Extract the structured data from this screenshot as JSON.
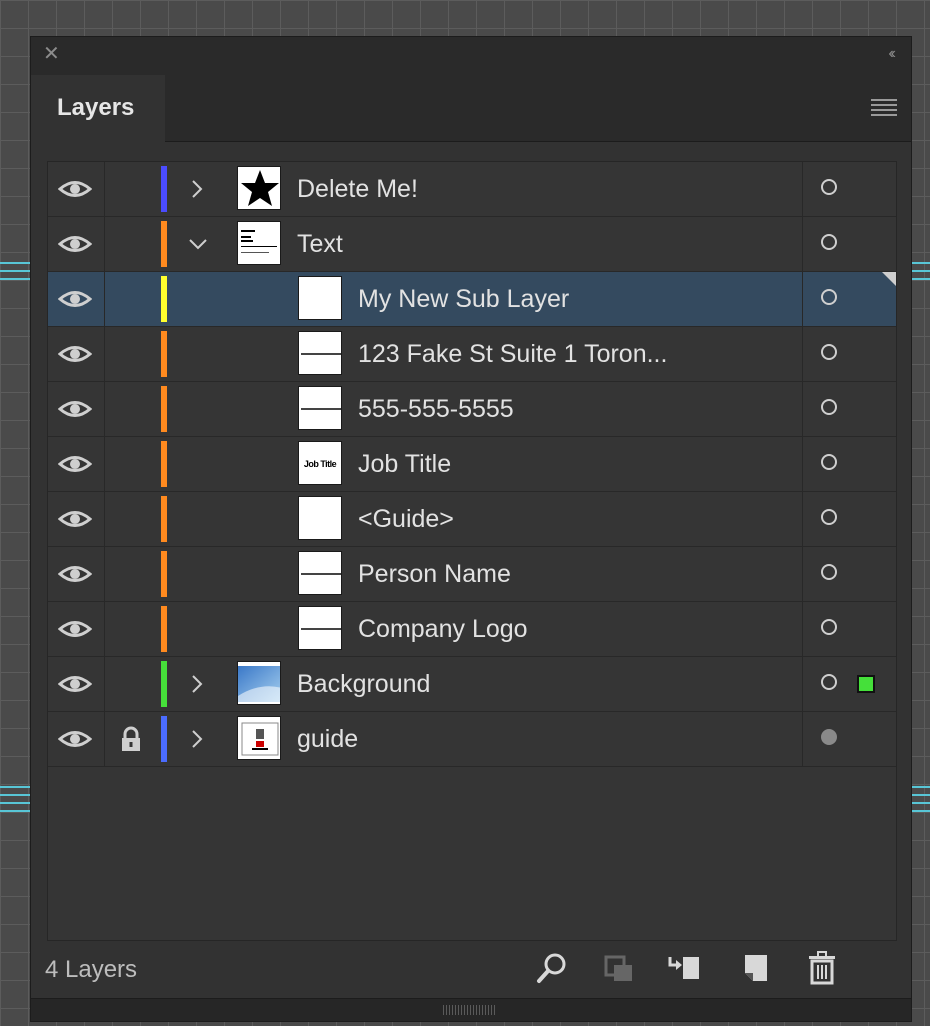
{
  "panel": {
    "tab_label": "Layers",
    "status": "4 Layers"
  },
  "layers": [
    {
      "name": "Delete Me!",
      "color": "#4b4cff",
      "expanded": false,
      "level": 0,
      "thumb": "star"
    },
    {
      "name": "Text",
      "color": "#ff8a1f",
      "expanded": true,
      "level": 0,
      "thumb": "text"
    },
    {
      "name": "My New Sub Layer",
      "color": "#ffff2e",
      "level": 1,
      "selected": true,
      "thumb": "blank"
    },
    {
      "name": "123 Fake St Suite 1 Toron...",
      "color": "#ff8a1f",
      "level": 1,
      "thumb": "line"
    },
    {
      "name": "555-555-5555",
      "color": "#ff8a1f",
      "level": 1,
      "thumb": "line"
    },
    {
      "name": "Job Title",
      "color": "#ff8a1f",
      "level": 1,
      "thumb": "jobtitle",
      "thumb_text": "Job Title"
    },
    {
      "name": "<Guide>",
      "color": "#ff8a1f",
      "level": 1,
      "thumb": "blank"
    },
    {
      "name": "Person Name",
      "color": "#ff8a1f",
      "level": 1,
      "thumb": "line"
    },
    {
      "name": "Company Logo",
      "color": "#ff8a1f",
      "level": 1,
      "thumb": "line"
    },
    {
      "name": "Background",
      "color": "#46e03a",
      "expanded": false,
      "level": 0,
      "thumb": "gradient",
      "has_selection": true
    },
    {
      "name": "guide",
      "color": "#4b6cff",
      "expanded": false,
      "level": 0,
      "thumb": "guide",
      "locked": true,
      "target_filled": true
    }
  ],
  "footer_icons": [
    "search-icon",
    "make-clipping-mask-icon",
    "create-sublayer-icon",
    "create-new-layer-icon",
    "delete-icon"
  ]
}
